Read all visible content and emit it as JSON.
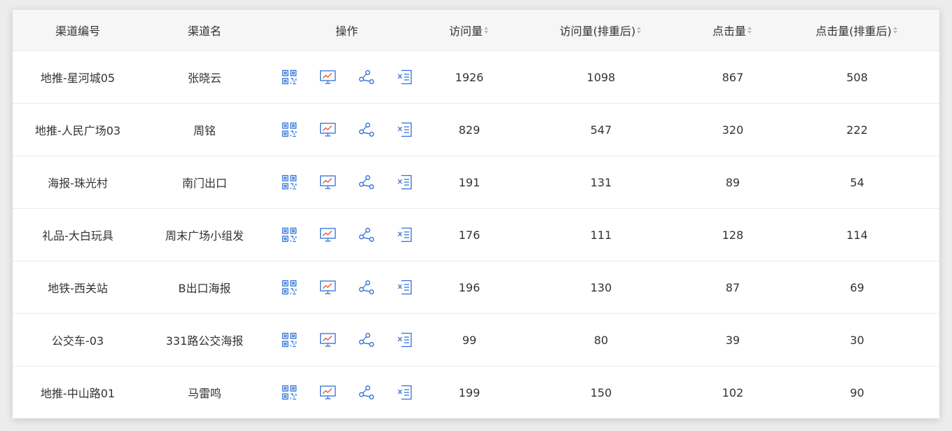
{
  "columns": {
    "code": "渠道编号",
    "name": "渠道名",
    "ops": "操作",
    "visits": "访问量",
    "visits_dedup": "访问量(排重后)",
    "clicks": "点击量",
    "clicks_dedup": "点击量(排重后)"
  },
  "icons": {
    "qr": "qr-code-icon",
    "chart": "chart-screen-icon",
    "share": "share-icon",
    "excel": "excel-export-icon",
    "sort": "sort-caret-icon",
    "accent": "#2f6fd6",
    "trend": "#e24d3a"
  },
  "rows": [
    {
      "code": "地推-星河城05",
      "name": "张晓云",
      "visits": "1926",
      "visits_dedup": "1098",
      "clicks": "867",
      "clicks_dedup": "508"
    },
    {
      "code": "地推-人民广场03",
      "name": "周铭",
      "visits": "829",
      "visits_dedup": "547",
      "clicks": "320",
      "clicks_dedup": "222"
    },
    {
      "code": "海报-珠光村",
      "name": "南门出口",
      "visits": "191",
      "visits_dedup": "131",
      "clicks": "89",
      "clicks_dedup": "54"
    },
    {
      "code": "礼品-大白玩具",
      "name": "周末广场小组发",
      "visits": "176",
      "visits_dedup": "111",
      "clicks": "128",
      "clicks_dedup": "114"
    },
    {
      "code": "地铁-西关站",
      "name": "B出口海报",
      "visits": "196",
      "visits_dedup": "130",
      "clicks": "87",
      "clicks_dedup": "69"
    },
    {
      "code": "公交车-03",
      "name": "331路公交海报",
      "visits": "99",
      "visits_dedup": "80",
      "clicks": "39",
      "clicks_dedup": "30"
    },
    {
      "code": "地推-中山路01",
      "name": "马雷鸣",
      "visits": "199",
      "visits_dedup": "150",
      "clicks": "102",
      "clicks_dedup": "90"
    }
  ]
}
